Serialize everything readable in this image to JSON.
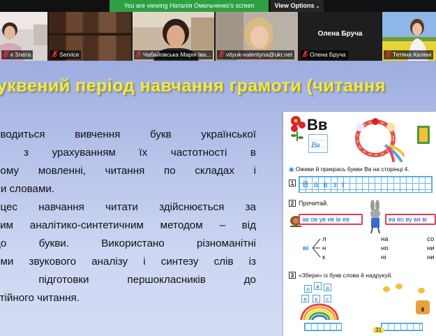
{
  "banner": {
    "viewing_text": "You are viewing Наталія Омельченко's screen",
    "view_options_label": "View Options"
  },
  "participants": [
    {
      "name": "к Злата",
      "muted": true
    },
    {
      "name": "Service",
      "muted": true
    },
    {
      "name": "Чабайовська Марія Іва...",
      "muted": true,
      "active": true
    },
    {
      "name": "vityuk-valentyna@ukr.net",
      "muted": true
    },
    {
      "name": "Олена Бруча",
      "muted": true,
      "display_name": "Олена Бруча"
    },
    {
      "name": "Тетяна Калені",
      "muted": true
    }
  ],
  "slide": {
    "title": "уквений період навчання грамоти (читання",
    "body_lines": [
      "оводиться вивчення букв української",
      "и з урахуванням їх частотності в",
      "ному мовленні, читання по складах і",
      "ли словами.",
      "оцес навчання читати здійснюється за",
      "вим аналітико-синтетичним методом – від",
      "до букви. Використано різноманітні",
      "оми звукового аналізу і синтезу слів із",
      "о підготовки першокласників до",
      "стійного читання."
    ]
  },
  "textbook": {
    "letters": "Вв",
    "task_intro": "Оживи й прикрась букви Вв на сторінці 4.",
    "task1_number": "1",
    "task1_letters": "В а в з г",
    "task2_number": "2",
    "task2_label": "Прочитай.",
    "row_syllables_left": "ав ов ув ив ів ев",
    "row_syllables_right": "ва во ву ви ві",
    "col1_head": "ві",
    "col1": [
      "л",
      "н",
      "к"
    ],
    "col2": [
      "на",
      "но",
      "ні"
    ],
    "col3": [
      "со",
      "ни",
      "ни"
    ],
    "task3_number": "3",
    "task3_label": "«Збери» із букв слова й надрукуй.",
    "task3_letters": [
      "л",
      "в",
      "а",
      "е",
      "к",
      "с"
    ],
    "page_number": "31"
  },
  "colors": {
    "banner_green": "#2ea043",
    "title_yellow": "#f2e84a",
    "active_speaker": "#c8d53a",
    "mic_red": "#e0302b"
  },
  "icons": {
    "muted": "mic-muted-icon",
    "chevron": "chevron-down-icon"
  }
}
